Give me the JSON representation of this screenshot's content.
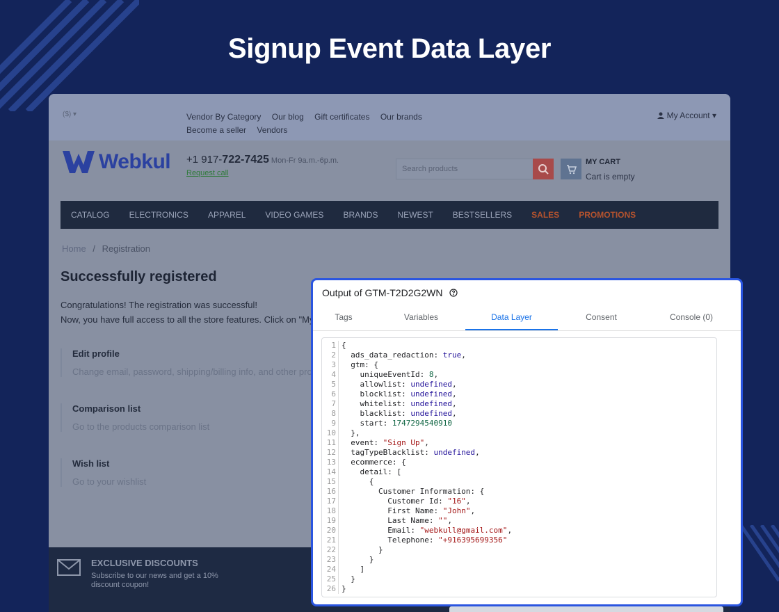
{
  "page": {
    "title": "Signup Event Data Layer"
  },
  "store": {
    "topbar": {
      "currency": "($)",
      "links": [
        "Vendor By Category",
        "Our blog",
        "Gift certificates",
        "Our brands",
        "Become a seller",
        "Vendors"
      ],
      "account": "My Account"
    },
    "header": {
      "logo_text": "Webkul",
      "phone_prefix": "+1 917-",
      "phone_main": "722-7425",
      "phone_hours": "Mon-Fr 9a.m.-6p.m.",
      "request_call": "Request call",
      "search_placeholder": "Search products",
      "cart_title": "MY CART",
      "cart_status": "Cart is empty"
    },
    "nav": [
      "CATALOG",
      "ELECTRONICS",
      "APPAREL",
      "VIDEO GAMES",
      "BRANDS",
      "NEWEST",
      "BESTSELLERS",
      "SALES",
      "PROMOTIONS"
    ],
    "breadcrumb": {
      "home": "Home",
      "separator": "/",
      "current": "Registration"
    },
    "registration": {
      "title": "Successfully registered",
      "line1": "Congratulations! The registration was successful!",
      "line2": "Now, you have full access to all the store features. Click on \"My"
    },
    "sections": [
      {
        "title": "Edit profile",
        "desc": "Change email, password, shipping/billing info, and other pro"
      },
      {
        "title": "Comparison list",
        "desc": "Go to the products comparison list"
      },
      {
        "title": "Wish list",
        "desc": "Go to your wishlist"
      }
    ],
    "footer": {
      "title": "EXCLUSIVE DISCOUNTS",
      "text": "Subscribe to our news and get a 10% discount coupon!"
    }
  },
  "gtm_panel": {
    "title": "Output of GTM-T2D2G2WN",
    "tabs": [
      "Tags",
      "Variables",
      "Data Layer",
      "Consent",
      "Console (0)"
    ],
    "active_tab": "Data Layer",
    "code_lines": [
      "{",
      "  ads_data_redaction: true,",
      "  gtm: {",
      "    uniqueEventId: 8,",
      "    allowlist: undefined,",
      "    blocklist: undefined,",
      "    whitelist: undefined,",
      "    blacklist: undefined,",
      "    start: 1747294540910",
      "  },",
      "  event: \"Sign Up\",",
      "  tagTypeBlacklist: undefined,",
      "  ecommerce: {",
      "    detail: [",
      "      {",
      "        Customer Information: {",
      "          Customer Id: \"16\",",
      "          First Name: \"John\",",
      "          Last Name: \"\",",
      "          Email: \"webkull@gmail.com\",",
      "          Telephone: \"+916395699356\"",
      "        }",
      "      }",
      "    ]",
      "  }",
      "}"
    ]
  },
  "colors": {
    "background": "#13245a",
    "panel_border": "#2a55e0",
    "active_tab": "#1a73e8",
    "nav_highlight": "#b5532e"
  }
}
